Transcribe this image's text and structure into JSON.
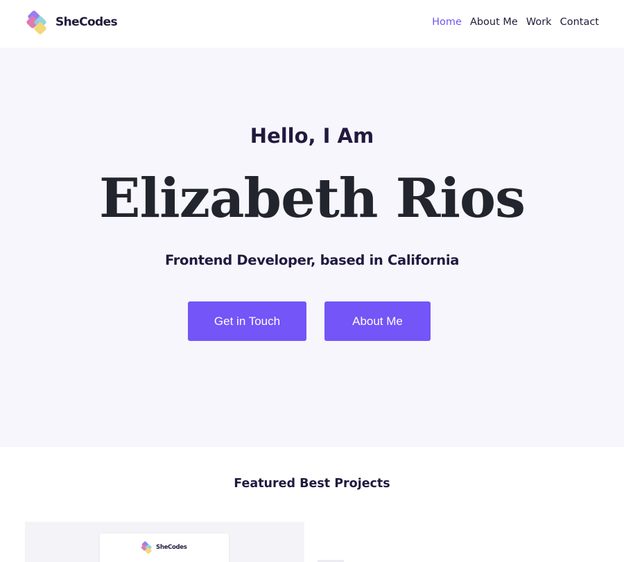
{
  "brand": {
    "name": "SheCodes",
    "logo_icon": "overlapping-diamonds-logo",
    "logo_colors": [
      "#d772b8",
      "#7ac9d9",
      "#f3d77a",
      "#9b7df0"
    ]
  },
  "nav": {
    "items": [
      {
        "label": "Home",
        "active": true
      },
      {
        "label": "About Me",
        "active": false
      },
      {
        "label": "Work",
        "active": false
      },
      {
        "label": "Contact",
        "active": false
      }
    ]
  },
  "hero": {
    "greeting": "Hello, I Am",
    "name": "Elizabeth Rios",
    "tagline": "Frontend Developer, based in California",
    "buttons": {
      "contact_label": "Get in Touch",
      "about_label": "About Me"
    }
  },
  "projects": {
    "title": "Featured Best Projects",
    "card_logo_text": "SheCodes"
  },
  "colors": {
    "accent": "#7355f8",
    "nav_active": "#6e55f7",
    "hero_background": "#f7f6fc",
    "text_dark": "#22193f"
  }
}
